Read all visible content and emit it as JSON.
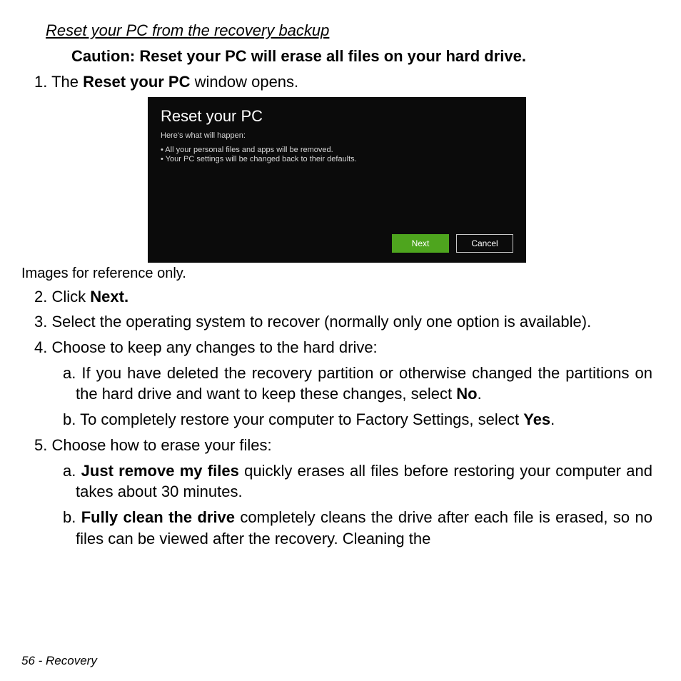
{
  "title": "Reset your PC from the recovery backup",
  "caution": "Caution: Reset your PC will erase all files on your hard drive.",
  "step1": {
    "num": "1.",
    "pre": "The ",
    "bold": "Reset your PC",
    "post": " window opens."
  },
  "screenshot": {
    "title": "Reset your PC",
    "subtitle": "Here's what will happen:",
    "bullet1": "• All your personal files and apps will be removed.",
    "bullet2": "• Your PC settings will be changed back to their defaults.",
    "next": "Next",
    "cancel": "Cancel"
  },
  "ref_note": "Images for reference only.",
  "step2": {
    "num": "2.",
    "pre": "Click ",
    "bold": "Next."
  },
  "step3": {
    "num": "3.",
    "text": "Select the operating system to recover (normally only one option is available)."
  },
  "step4": {
    "num": "4.",
    "text": "Choose to keep any changes to the hard drive:"
  },
  "step4a": {
    "num": "a.",
    "pre": "If you have deleted the recovery partition or otherwise changed the partitions on the hard drive and want to keep these changes, select ",
    "bold": "No",
    "post": "."
  },
  "step4b": {
    "num": "b.",
    "pre": "To completely restore your computer to Factory Settings, select ",
    "bold": "Yes",
    "post": "."
  },
  "step5": {
    "num": "5.",
    "text": "Choose how to erase your files:"
  },
  "step5a": {
    "num": "a.",
    "bold": "Just remove my files",
    "post": " quickly erases all files before restoring your computer and takes about 30 minutes."
  },
  "step5b": {
    "num": "b.",
    "bold": "Fully clean the drive",
    "post": " completely cleans the drive after each file is erased, so no files can be viewed after the recovery. Cleaning the"
  },
  "footer": "56 - Recovery"
}
